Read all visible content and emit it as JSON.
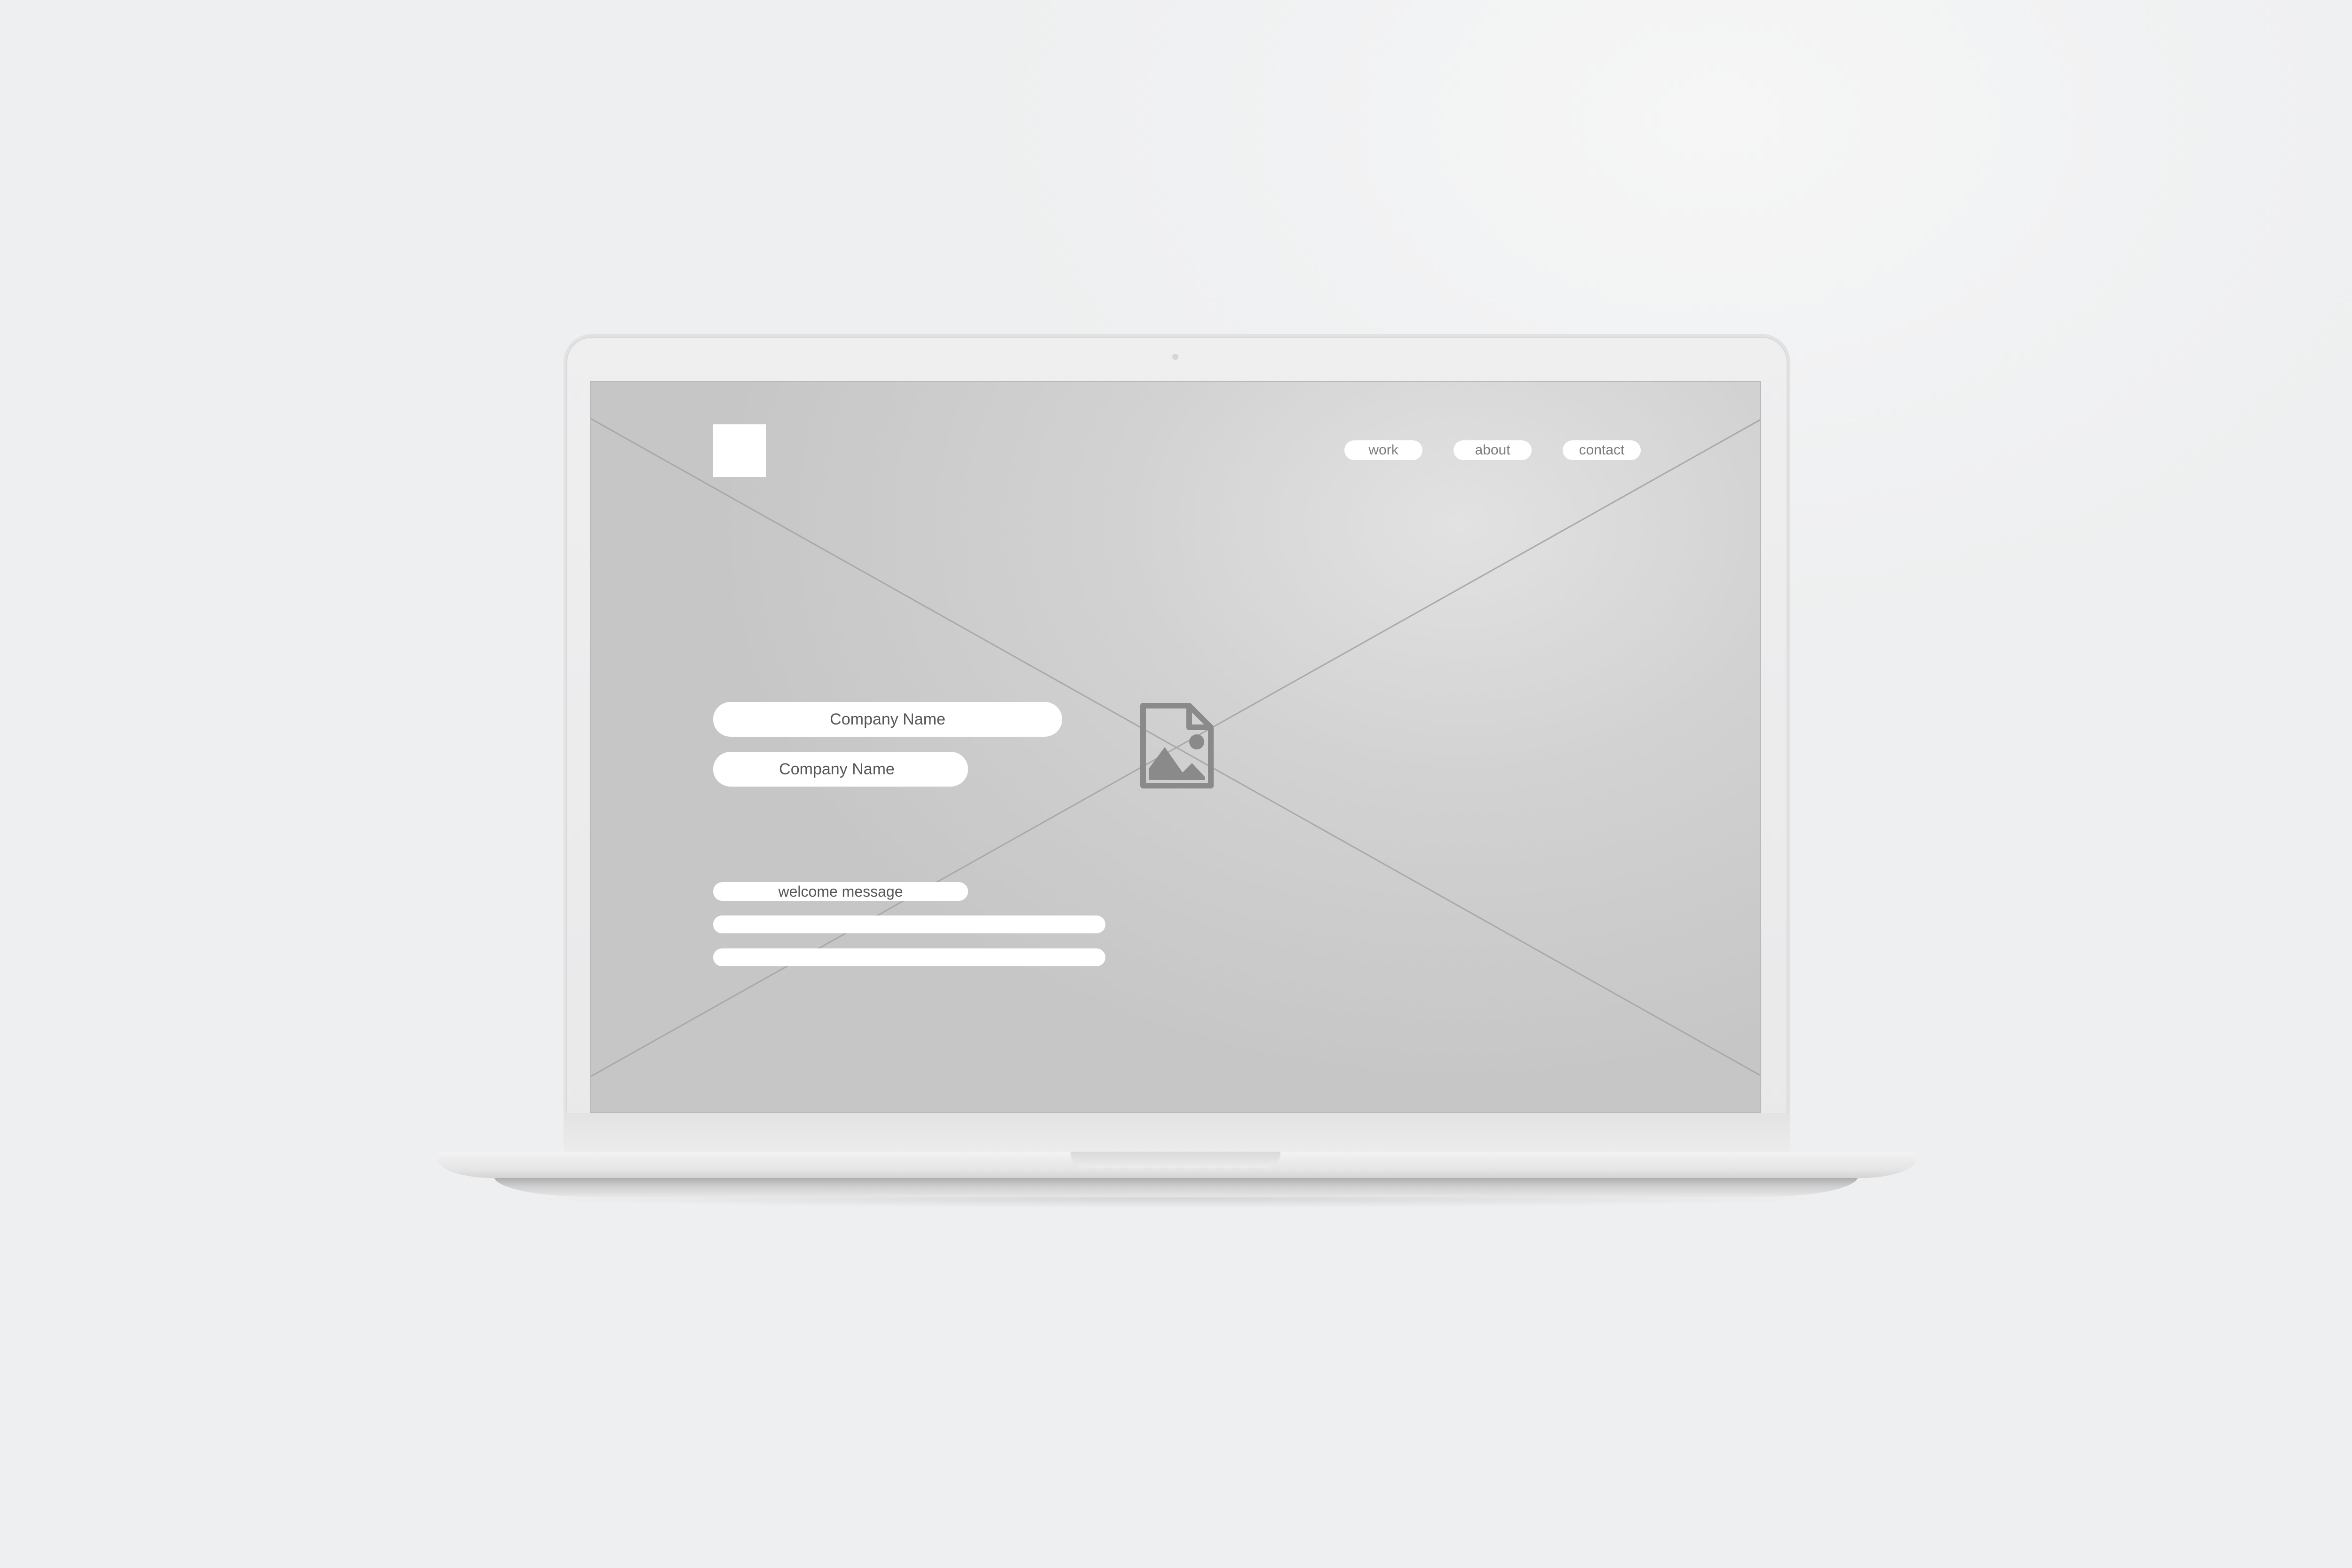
{
  "nav": {
    "work": "work",
    "about": "about",
    "contact": "contact"
  },
  "hero": {
    "title": "Company Name",
    "subtitle": "Company Name",
    "welcome": "welcome message"
  },
  "icons": {
    "logo": "logo-placeholder",
    "hero_image": "image-placeholder-icon"
  },
  "colors": {
    "screen_background": "#c9c9c9",
    "pill_fill": "#ffffff",
    "placeholder_icon": "#8a8a8a"
  }
}
